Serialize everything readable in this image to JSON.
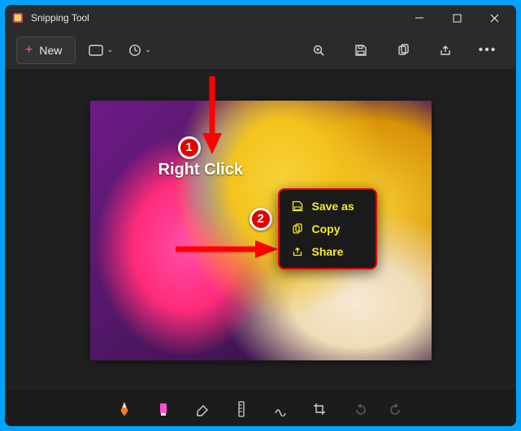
{
  "window": {
    "title": "Snipping Tool",
    "controls": {
      "minimize": "–",
      "maximize": "□",
      "close": "✕"
    }
  },
  "toolbar": {
    "new_label": "New",
    "new_plus": "+"
  },
  "annotations": {
    "badge1": "1",
    "badge2": "2",
    "right_click_label": "Right Click"
  },
  "context_menu": {
    "items": [
      {
        "icon": "save-icon",
        "label": "Save as"
      },
      {
        "icon": "copy-icon",
        "label": "Copy"
      },
      {
        "icon": "share-icon",
        "label": "Share"
      }
    ]
  },
  "bottom_tools": [
    "pen-red",
    "highlighter",
    "eraser",
    "ruler",
    "touch-writing",
    "crop",
    "undo",
    "redo"
  ]
}
